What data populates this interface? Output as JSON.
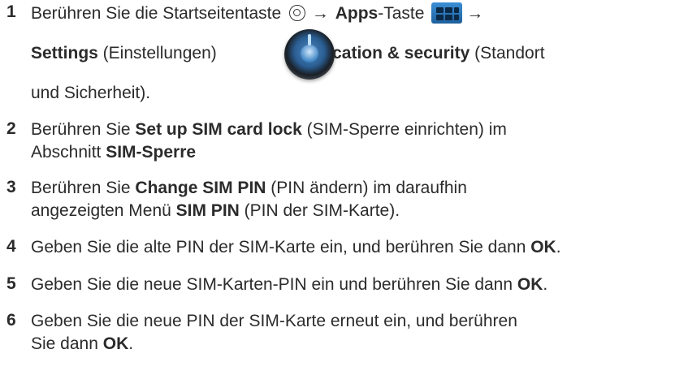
{
  "steps": [
    {
      "num": "1",
      "lines": [
        {
          "segments": [
            "Berühren Sie die Startseitentaste",
            "→",
            "Apps",
            "-Taste",
            "→"
          ]
        },
        {
          "segments": [
            "Settings",
            " (Einstellungen) ",
            "→",
            "Location & security",
            " (Standort"
          ]
        },
        {
          "segments": [
            "und Sicherheit)."
          ]
        }
      ]
    },
    {
      "num": "2",
      "lines": [
        {
          "segments": [
            "Berühren Sie ",
            "Set up SIM card lock",
            " (SIM-Sperre einrichten) im"
          ]
        },
        {
          "segments": [
            "Abschnitt ",
            "SIM-Sperre"
          ]
        }
      ]
    },
    {
      "num": "3",
      "lines": [
        {
          "segments": [
            "Berühren Sie ",
            "Change SIM PIN",
            " (PIN ändern) im daraufhin"
          ]
        },
        {
          "segments": [
            "angezeigten Menü ",
            "SIM PIN",
            " (PIN der SIM-Karte)."
          ]
        }
      ]
    },
    {
      "num": "4",
      "lines": [
        {
          "segments": [
            "Geben Sie die alte PIN der SIM-Karte ein, und berühren Sie dann ",
            "OK",
            "."
          ]
        }
      ]
    },
    {
      "num": "5",
      "lines": [
        {
          "segments": [
            "Geben Sie die neue SIM-Karten-PIN ein und berühren Sie dann ",
            "OK",
            "."
          ]
        }
      ]
    },
    {
      "num": "6",
      "lines": [
        {
          "segments": [
            "Geben Sie die neue PIN der SIM-Karte erneut ein, und berühren"
          ]
        },
        {
          "segments": [
            "Sie dann ",
            "OK",
            "."
          ]
        }
      ]
    }
  ],
  "icons": {
    "home": "home-icon",
    "apps": "apps-grid-icon",
    "settings": "settings-icon"
  }
}
